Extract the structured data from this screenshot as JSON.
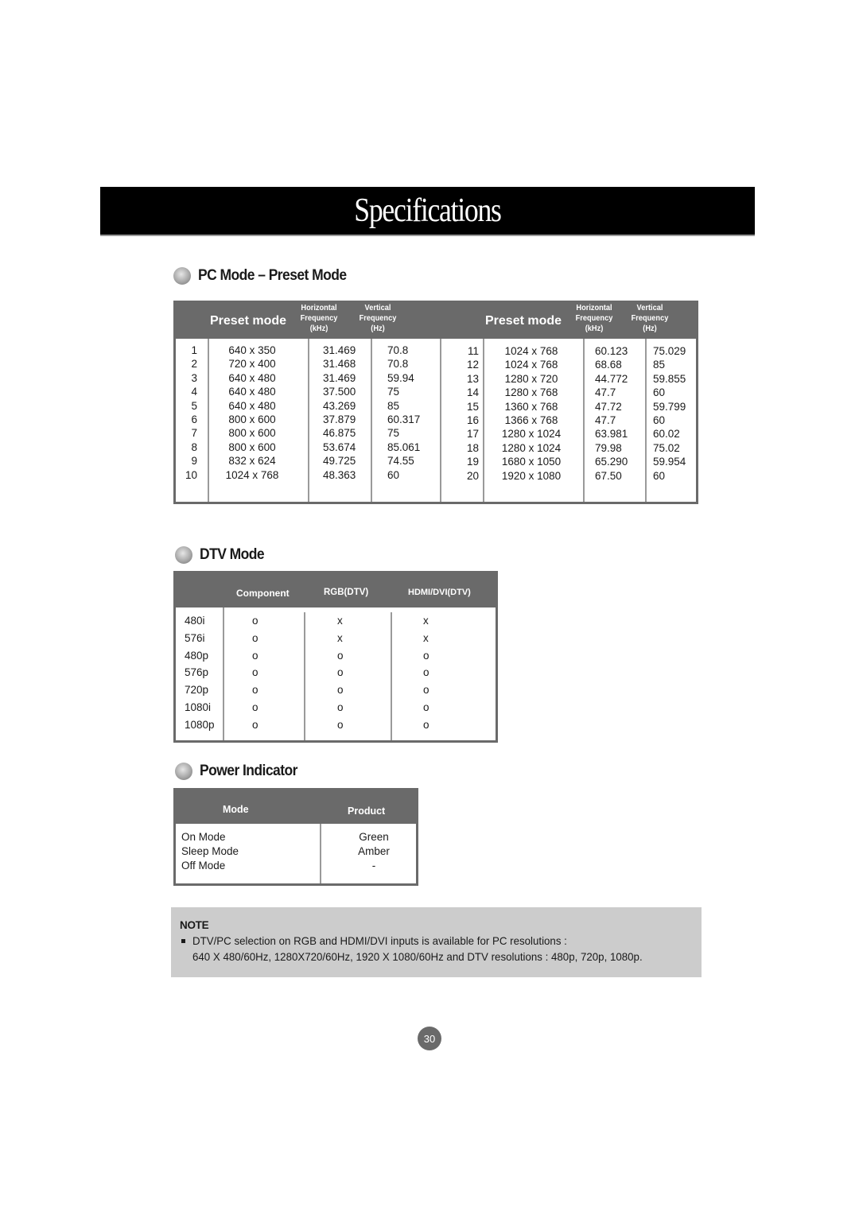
{
  "page": {
    "title": "Specifications",
    "page_number": "30"
  },
  "pc_mode": {
    "heading": "PC Mode – Preset Mode",
    "headers": {
      "preset_mode": "Preset mode",
      "horizontal_frequency": [
        "Horizontal",
        "Frequency",
        "(kHz)"
      ],
      "vertical_frequency": [
        "Vertical",
        "Frequency",
        "(Hz)"
      ]
    },
    "rows": [
      {
        "no": "1",
        "resolution": "640 x 350",
        "h_freq": "31.469",
        "v_freq": "70.8"
      },
      {
        "no": "2",
        "resolution": "720 x 400",
        "h_freq": "31.468",
        "v_freq": "70.8"
      },
      {
        "no": "3",
        "resolution": "640 x 480",
        "h_freq": "31.469",
        "v_freq": "59.94"
      },
      {
        "no": "4",
        "resolution": "640 x 480",
        "h_freq": "37.500",
        "v_freq": "75"
      },
      {
        "no": "5",
        "resolution": "640 x 480",
        "h_freq": "43.269",
        "v_freq": "85"
      },
      {
        "no": "6",
        "resolution": "800 x 600",
        "h_freq": "37.879",
        "v_freq": "60.317"
      },
      {
        "no": "7",
        "resolution": "800 x 600",
        "h_freq": "46.875",
        "v_freq": "75"
      },
      {
        "no": "8",
        "resolution": "800 x 600",
        "h_freq": "53.674",
        "v_freq": "85.061"
      },
      {
        "no": "9",
        "resolution": "832 x 624",
        "h_freq": "49.725",
        "v_freq": "74.55"
      },
      {
        "no": "10",
        "resolution": "1024 x 768",
        "h_freq": "48.363",
        "v_freq": "60"
      },
      {
        "no": "11",
        "resolution": "1024 x 768",
        "h_freq": "60.123",
        "v_freq": "75.029"
      },
      {
        "no": "12",
        "resolution": "1024 x 768",
        "h_freq": "68.68",
        "v_freq": "85"
      },
      {
        "no": "13",
        "resolution": "1280 x 720",
        "h_freq": "44.772",
        "v_freq": "59.855"
      },
      {
        "no": "14",
        "resolution": "1280 x 768",
        "h_freq": "47.7",
        "v_freq": "60"
      },
      {
        "no": "15",
        "resolution": "1360 x 768",
        "h_freq": "47.72",
        "v_freq": "59.799"
      },
      {
        "no": "16",
        "resolution": "1366 x 768",
        "h_freq": "47.7",
        "v_freq": "60"
      },
      {
        "no": "17",
        "resolution": "1280 x 1024",
        "h_freq": "63.981",
        "v_freq": "60.02"
      },
      {
        "no": "18",
        "resolution": "1280 x 1024",
        "h_freq": "79.98",
        "v_freq": "75.02"
      },
      {
        "no": "19",
        "resolution": "1680 x 1050",
        "h_freq": "65.290",
        "v_freq": "59.954"
      },
      {
        "no": "20",
        "resolution": "1920 x 1080",
        "h_freq": "67.50",
        "v_freq": "60"
      }
    ]
  },
  "dtv_mode": {
    "heading": "DTV Mode",
    "headers": [
      "Component",
      "RGB(DTV)",
      "HDMI/DVI(DTV)"
    ],
    "rows": [
      {
        "mode": "480i",
        "component": "o",
        "rgb": "x",
        "hdmi": "x"
      },
      {
        "mode": "576i",
        "component": "o",
        "rgb": "x",
        "hdmi": "x"
      },
      {
        "mode": "480p",
        "component": "o",
        "rgb": "o",
        "hdmi": "o"
      },
      {
        "mode": "576p",
        "component": "o",
        "rgb": "o",
        "hdmi": "o"
      },
      {
        "mode": "720p",
        "component": "o",
        "rgb": "o",
        "hdmi": "o"
      },
      {
        "mode": "1080i",
        "component": "o",
        "rgb": "o",
        "hdmi": "o"
      },
      {
        "mode": "1080p",
        "component": "o",
        "rgb": "o",
        "hdmi": "o"
      }
    ]
  },
  "power_indicator": {
    "heading": "Power Indicator",
    "headers": [
      "Mode",
      "Product"
    ],
    "rows": [
      {
        "mode": "On Mode",
        "product": "Green"
      },
      {
        "mode": "Sleep Mode",
        "product": "Amber"
      },
      {
        "mode": "Off Mode",
        "product": "-"
      }
    ]
  },
  "note": {
    "label": "NOTE",
    "line1": "DTV/PC selection on RGB and HDMI/DVI inputs is available for PC resolutions :",
    "line2": "640 X 480/60Hz, 1280X720/60Hz, 1920 X 1080/60Hz and DTV resolutions : 480p, 720p, 1080p."
  }
}
